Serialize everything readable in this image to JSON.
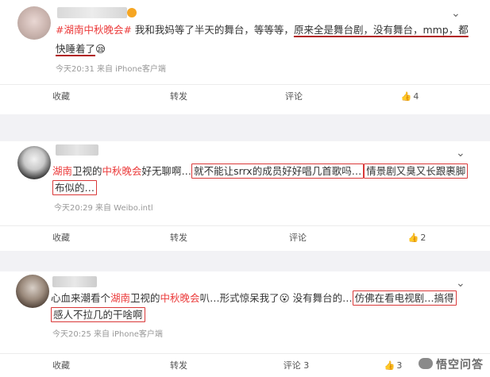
{
  "posts": [
    {
      "segments": [
        {
          "text": "#湖南中秋晚会#",
          "style": "tag"
        },
        {
          "text": " 我和我妈等了半天的舞台，等等等，",
          "style": ""
        },
        {
          "text": "原来全是舞台剧，没有舞台，mmp，都",
          "style": "ul"
        }
      ],
      "line2": [
        {
          "text": "快睡着了",
          "style": "ul"
        },
        {
          "text": "😪",
          "style": ""
        }
      ],
      "meta": "今天20:31  来自 iPhone客户端",
      "actions": [
        "收藏",
        "转发",
        "评论",
        "4"
      ]
    },
    {
      "segments": [
        {
          "text": "湖南",
          "style": "red"
        },
        {
          "text": "卫视的",
          "style": ""
        },
        {
          "text": "中秋晚会",
          "style": "red"
        },
        {
          "text": "好无聊啊…",
          "style": ""
        },
        {
          "text": "就不能让srrx的成员好好唱几首歌吗…",
          "style": "hl"
        },
        {
          "text": "情景剧又臭又长跟裹脚",
          "style": "hl"
        }
      ],
      "line2": [
        {
          "text": "布似的…",
          "style": "hl"
        }
      ],
      "meta": "今天20:29  来自 Weibo.intl",
      "actions": [
        "收藏",
        "转发",
        "评论",
        "2"
      ]
    },
    {
      "segments": [
        {
          "text": "心血来潮看个",
          "style": ""
        },
        {
          "text": "湖南",
          "style": "red"
        },
        {
          "text": "卫视的",
          "style": ""
        },
        {
          "text": "中秋晚会",
          "style": "red"
        },
        {
          "text": "叭…形式惊呆我了",
          "style": ""
        },
        {
          "text": "😮",
          "style": ""
        },
        {
          "text": " 没有舞台的…",
          "style": ""
        },
        {
          "text": "仿佛在看电视剧…搞得",
          "style": "hl"
        }
      ],
      "line2": [
        {
          "text": "感人不拉几的干啥啊",
          "style": "hl"
        }
      ],
      "meta": "今天20:25  来自 iPhone客户端",
      "actions": [
        "收藏",
        "转发",
        "评论 3",
        "3"
      ]
    }
  ],
  "watermark": "悟空问答",
  "colors": {
    "tag": "#eb3a3a",
    "highlight_box": "#d93838",
    "separator": "#f2f2f5"
  }
}
